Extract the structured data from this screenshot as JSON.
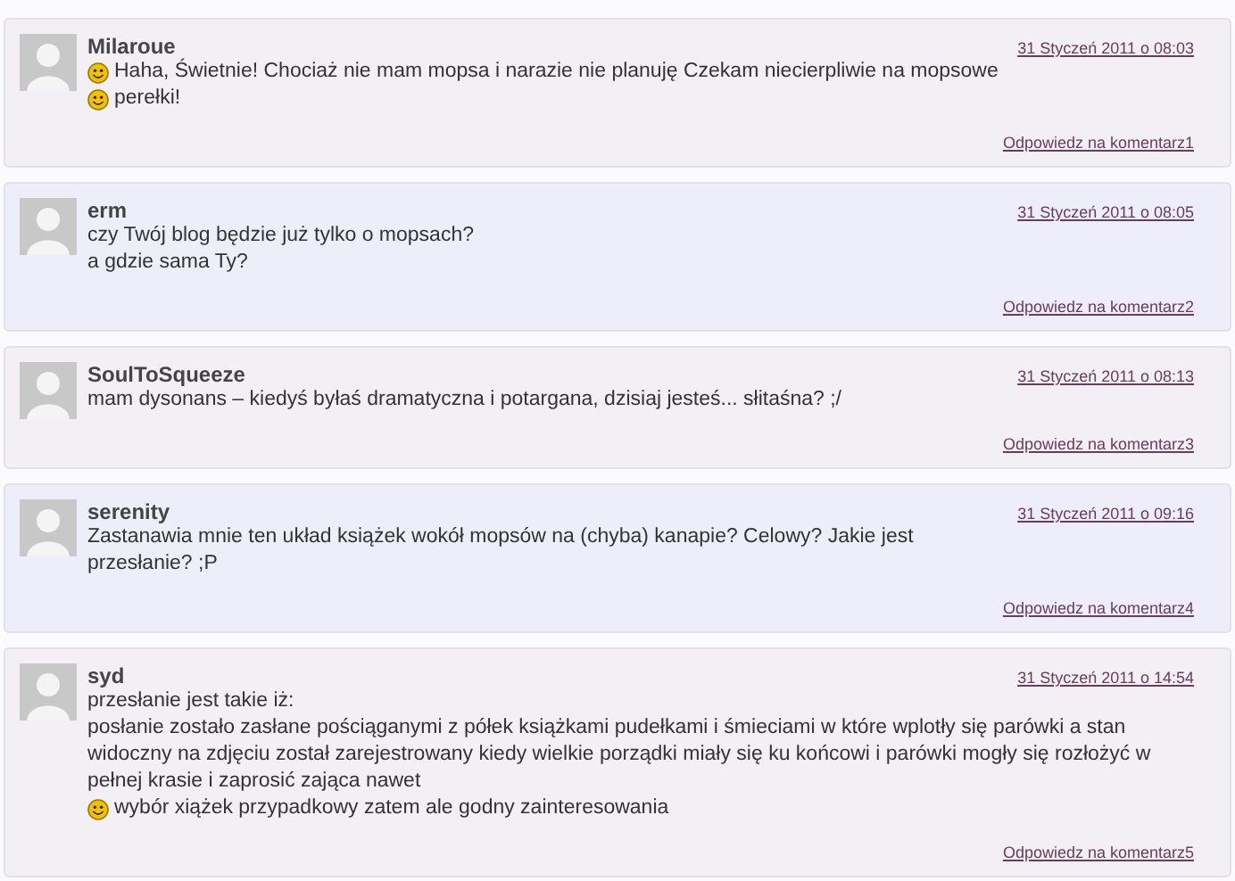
{
  "comments": [
    {
      "author": "Milaroue",
      "date": "31 Styczeń 2011 o 08:03",
      "color": "#f2f0f4",
      "lines": [
        {
          "text": "Haha, Świetnie! Chociaż nie mam mopsa i narazie nie planuję Czekam niecierpliwie na mopsowe",
          "smiley": true
        },
        {
          "text": "perełki!",
          "smiley": true
        }
      ],
      "reply": "Odpowiedz na komentarz1"
    },
    {
      "author": "erm",
      "date": "31 Styczeń 2011 o 08:05",
      "color": "#eeeefa",
      "lines": [
        {
          "text": "czy Twój blog będzie już tylko o mopsach?",
          "smiley": false
        },
        {
          "text": "a gdzie sama Ty?",
          "smiley": false
        }
      ],
      "reply": "Odpowiedz na komentarz2"
    },
    {
      "author": "SoulToSqueeze",
      "date": "31 Styczeń 2011 o 08:13",
      "color": "#f2f0f4",
      "lines": [
        {
          "text": "mam dysonans – kiedyś byłaś dramatyczna i potargana, dzisiaj jesteś... słitaśna? ;/",
          "smiley": false
        }
      ],
      "reply": "Odpowiedz na komentarz3"
    },
    {
      "author": "serenity",
      "date": "31 Styczeń 2011 o 09:16",
      "color": "#eeeefa",
      "lines": [
        {
          "text": "Zastanawia mnie ten układ książek wokół mopsów na (chyba) kanapie? Celowy? Jakie jest",
          "smiley": false
        },
        {
          "text": "przesłanie? ;P",
          "smiley": false
        }
      ],
      "reply": "Odpowiedz na komentarz4"
    },
    {
      "author": "syd",
      "date": "31 Styczeń 2011 o 14:54",
      "color": "#f2f0f4",
      "lines": [
        {
          "text": "przesłanie jest takie iż:",
          "smiley": false
        },
        {
          "text": "posłanie zostało zasłane pościąganymi z półek książkami pudełkami i śmieciami w które wplotły się parówki a stan",
          "smiley": false
        },
        {
          "text": "widoczny na zdjęciu został zarejestrowany kiedy wielkie porządki miały się ku końcowi i parówki mogły się rozłożyć w",
          "smiley": false
        },
        {
          "text": "pełnej krasie i zaprosić zająca nawet",
          "smiley": false
        },
        {
          "text": "wybór xiążek przypadkowy zatem ale godny zainteresowania",
          "smiley": true
        }
      ],
      "reply": "Odpowiedz na komentarz5"
    }
  ]
}
